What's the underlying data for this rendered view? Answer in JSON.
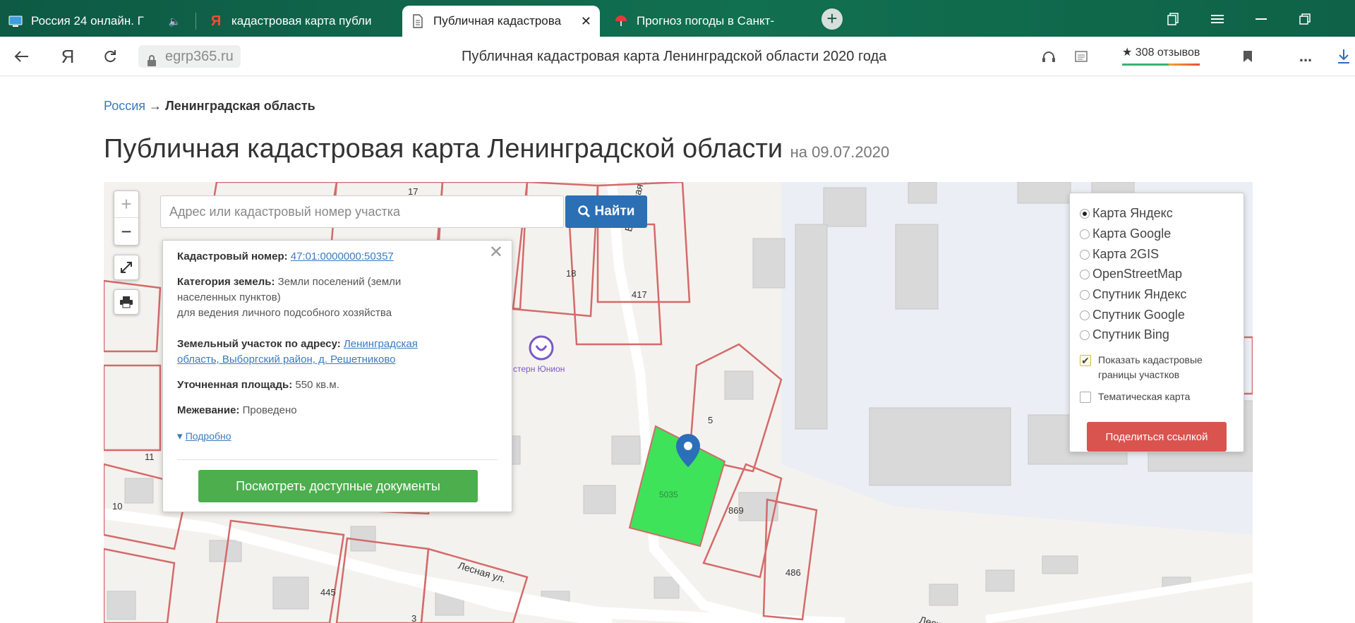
{
  "browser": {
    "tabs": [
      {
        "label": "Россия 24 онлайн. Г",
        "icon": "tv-icon"
      },
      {
        "label": "кадастровая карта публи",
        "icon": "yandex-icon"
      },
      {
        "label": "Публичная кадастрова",
        "icon": "page-icon",
        "active": true,
        "close": "✕"
      },
      {
        "label": "Прогноз погоды в Санкт-",
        "icon": "umbrella-icon"
      }
    ],
    "new_tab": "+",
    "address": {
      "domain": "egrp365.ru",
      "page_title": "Публичная кадастровая карта Ленинградской области 2020 года",
      "yandex_button": "Я",
      "reviews": "★ 308 отзывов",
      "menu_dots": "..."
    }
  },
  "breadcrumb": {
    "root": "Россия",
    "arrow": "→",
    "current": "Ленинградская область"
  },
  "heading": {
    "title": "Публичная кадастровая карта Ленинградской области",
    "date": "на 09.07.2020"
  },
  "map": {
    "zoom_in": "+",
    "zoom_out": "−",
    "search_placeholder": "Адрес или кадастровый номер участка",
    "find_label": "Найти",
    "popup": {
      "close": "✕",
      "cadastral_label": "Кадастровый номер:",
      "cadastral_value": "47:01:0000000:50357",
      "category_label": "Категория земель:",
      "category_value_1": "Земли поселений (земли",
      "category_value_2": "населенных пунктов)",
      "category_value_3": "для ведения личного подсобного хозяйства",
      "address_label": "Земельный участок по адресу:",
      "address_value_1": "Ленинградская",
      "address_value_2": "область, Выборгский район, д. Решетниково",
      "area_label": "Уточненная площадь:",
      "area_value": "550 кв.м.",
      "survey_label": "Межевание:",
      "survey_value": "Проведено",
      "details_arrow": "▾",
      "details": "Подробно",
      "documents_button": "Посмотреть доступные документы"
    },
    "layers": {
      "options": [
        {
          "label": "Карта Яндекс",
          "selected": true
        },
        {
          "label": "Карта Google",
          "selected": false
        },
        {
          "label": "Карта 2GIS",
          "selected": false
        },
        {
          "label": "OpenStreetMap",
          "selected": false
        },
        {
          "label": "Спутник Яндекс",
          "selected": false
        },
        {
          "label": "Спутник Google",
          "selected": false
        },
        {
          "label": "Спутник Bing",
          "selected": false
        }
      ],
      "show_borders_1": "Показать кадастровые",
      "show_borders_2": "границы участков",
      "show_borders_checked": true,
      "thematic": "Тематическая карта",
      "thematic_checked": false,
      "share_button": "Поделиться ссылкой"
    },
    "labels": {
      "n17": "17",
      "n18": "18",
      "n417": "417",
      "n5": "5",
      "n11": "11",
      "n10": "10",
      "n869": "869",
      "n486": "486",
      "n445": "445",
      "n3": "3",
      "parcel": "5035",
      "street1": "Березовая у",
      "street2": "Лесная ул.",
      "street3": "Лесна",
      "poi": "стерн Юнион"
    },
    "colors": {
      "parcel_fill": "#3ee35a",
      "parcel_border": "#d46a6a",
      "pin": "#2a6fb8",
      "find_button": "#2b6fb5",
      "docs_button": "#4cae4c",
      "share_button": "#d9534f"
    }
  }
}
